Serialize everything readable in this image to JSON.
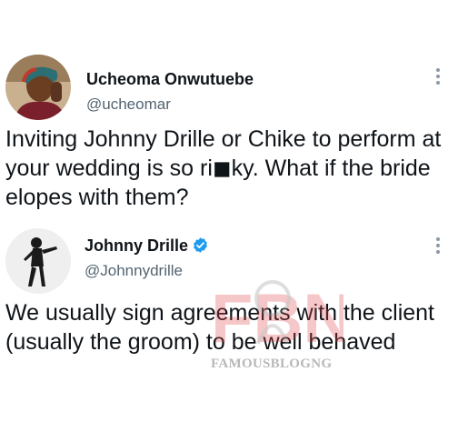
{
  "tweet1": {
    "author_name": "Ucheoma Onwutuebe",
    "handle": "@ucheomar",
    "text": "Inviting Johnny Drille or Chike to perform at your wedding is so ri◼ky. What if the bride elopes with them?",
    "avatar_icon": "user-photo"
  },
  "tweet2": {
    "author_name": "Johnny Drille",
    "handle": "@Johnnydrille",
    "verified": true,
    "text": "We usually sign agreements with the client (usually the groom) to be well behaved",
    "avatar_icon": "singer-silhouette"
  },
  "watermark": {
    "logo_text": "FBN",
    "text": "FAMOUSBLOGNG"
  },
  "colors": {
    "text": "#0f1419",
    "secondary": "#536471",
    "verified": "#1d9bf0",
    "watermark_red": "#e0474c"
  }
}
